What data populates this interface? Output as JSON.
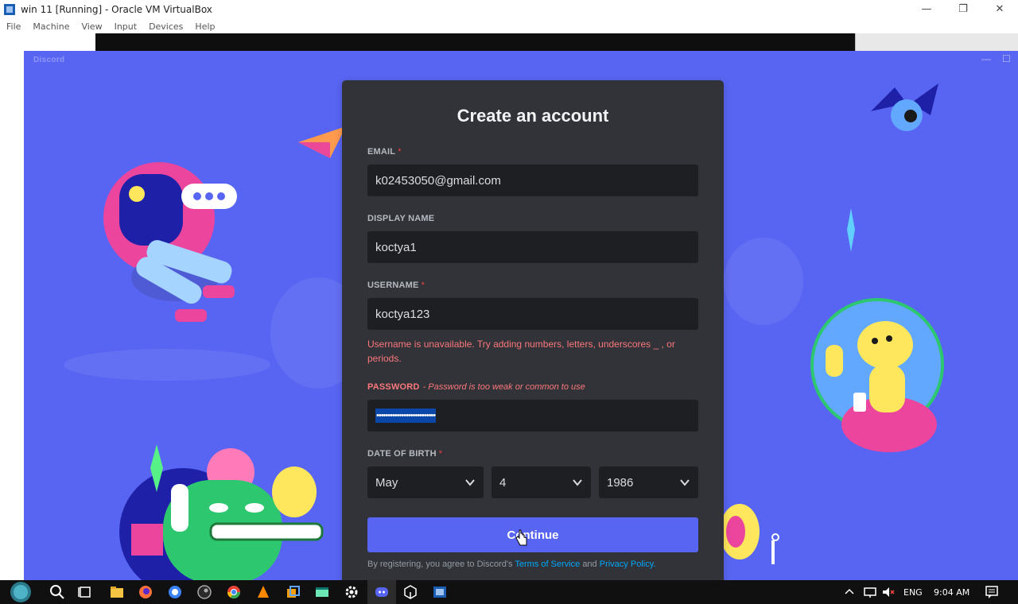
{
  "host": {
    "title": "win 11 [Running] - Oracle VM VirtualBox",
    "menu": [
      "File",
      "Machine",
      "View",
      "Input",
      "Devices",
      "Help"
    ],
    "buttons": {
      "minimize": "—",
      "restore": "❐",
      "close": "✕"
    }
  },
  "discord": {
    "wordmark": "Discord",
    "window_buttons": {
      "minimize": "—",
      "maximize": "☐"
    }
  },
  "form": {
    "title": "Create an account",
    "email": {
      "label": "EMAIL",
      "required": "*",
      "value": "k02453050@gmail.com"
    },
    "display_name": {
      "label": "DISPLAY NAME",
      "value": "koctya1"
    },
    "username": {
      "label": "USERNAME",
      "required": "*",
      "value": "koctya123",
      "error": "Username is unavailable. Try adding numbers, letters, underscores _ , or periods."
    },
    "password": {
      "label": "PASSWORD",
      "error": "- Password is too weak or common to use",
      "value": "••••••••••••••••••••••••••"
    },
    "dob": {
      "label": "DATE OF BIRTH",
      "required": "*",
      "month": "May",
      "day": "4",
      "year": "1986"
    },
    "continue": "Continue",
    "terms": {
      "prefix": "By registering, you agree to Discord's",
      "tos": "Terms of Service",
      "and": "and",
      "privacy": "Privacy Policy."
    }
  },
  "taskbar": {
    "language": "ENG",
    "time": "9:04 AM"
  },
  "colors": {
    "background": "#5865f2",
    "card": "#313338",
    "input": "#1e1f22",
    "error": "#fa777c",
    "link": "#00a8fc"
  }
}
